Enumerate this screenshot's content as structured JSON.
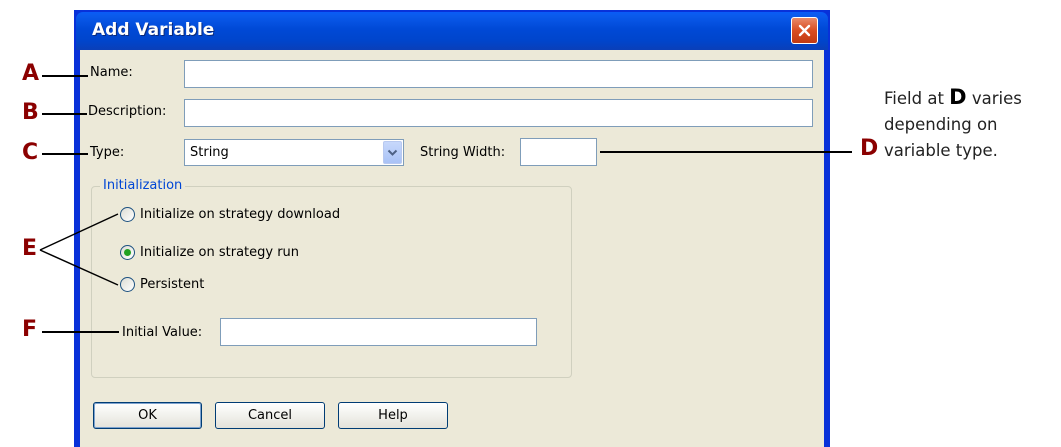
{
  "window": {
    "title": "Add Variable"
  },
  "form": {
    "name_label": "Name:",
    "name_value": "",
    "description_label": "Description:",
    "description_value": "",
    "type_label": "Type:",
    "type_value": "String",
    "string_width_label": "String Width:",
    "string_width_value": ""
  },
  "initialization": {
    "group_label": "Initialization",
    "options": [
      {
        "label": "Initialize on strategy download",
        "selected": false
      },
      {
        "label": "Initialize on strategy run",
        "selected": true
      },
      {
        "label": "Persistent",
        "selected": false
      }
    ],
    "initial_value_label": "Initial Value:",
    "initial_value": ""
  },
  "buttons": {
    "ok": "OK",
    "cancel": "Cancel",
    "help": "Help"
  },
  "callouts": {
    "a": "A",
    "b": "B",
    "c": "C",
    "d": "D",
    "e": "E",
    "f": "F"
  },
  "note": {
    "prefix": "Field at ",
    "letter": "D",
    "suffix": " varies depending on variable type."
  },
  "colors": {
    "title_bar": "#0054e3",
    "callout": "#8b0000",
    "group_label": "#0046d5",
    "selected_radio": "#21a121"
  },
  "icons": [
    "close-icon",
    "chevron-down-icon"
  ]
}
